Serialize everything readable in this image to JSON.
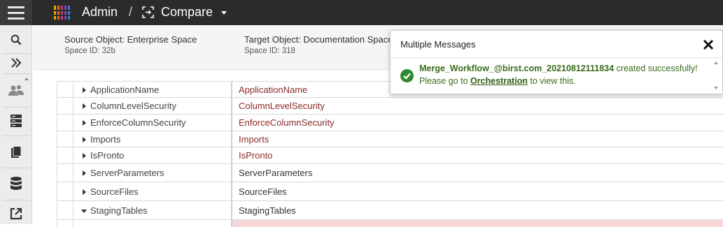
{
  "topbar": {
    "app_title": "Admin",
    "separator": "/",
    "section_label": "Compare"
  },
  "icons": {
    "menu": "hamburger-icon",
    "logo": "birst-logo-icon",
    "compare": "compare-icon",
    "dropdown": "caret-down-icon",
    "search": "search-icon",
    "expand": "double-chevron-right-icon",
    "users": "users-icon",
    "servers": "server-icon",
    "documents": "documents-icon",
    "database": "database-icon",
    "export": "export-icon",
    "close": "close-icon",
    "success": "check-circle-icon"
  },
  "colors": {
    "topbar_bg": "#2b2b2b",
    "sidebar_bg": "#ececec",
    "diff_text": "#8b2a2a",
    "same_text": "#333333",
    "success_green": "#2e8b2e",
    "message_text": "#3a6b1a"
  },
  "compare_header": {
    "source_object_label": "Source Object: Enterprise Space",
    "source_space_id": "Space ID: 32b",
    "target_object_label": "Target Object: Documentation Space",
    "target_space_id": "Space ID: 318"
  },
  "rows": [
    {
      "name": "ApplicationName",
      "value": "ApplicationName",
      "expanded": false,
      "differs": true
    },
    {
      "name": "ColumnLevelSecurity",
      "value": "ColumnLevelSecurity",
      "expanded": false,
      "differs": true
    },
    {
      "name": "EnforceColumnSecurity",
      "value": "EnforceColumnSecurity",
      "expanded": false,
      "differs": true
    },
    {
      "name": "Imports",
      "value": "Imports",
      "expanded": false,
      "differs": true
    },
    {
      "name": "IsPronto",
      "value": "IsPronto",
      "expanded": false,
      "differs": true
    },
    {
      "name": "ServerParameters",
      "value": "ServerParameters",
      "expanded": false,
      "differs": false
    },
    {
      "name": "SourceFiles",
      "value": "SourceFiles",
      "expanded": false,
      "differs": false
    },
    {
      "name": "StagingTables",
      "value": "StagingTables",
      "expanded": true,
      "differs": false
    }
  ],
  "toast": {
    "title": "Multiple Messages",
    "workflow_name": "Merge_Workflow_@birst.com_20210812111834",
    "created_text": " created successfully!",
    "goto_text": "Please go to ",
    "link_text": "Orchestration",
    "view_text": " to view this."
  }
}
